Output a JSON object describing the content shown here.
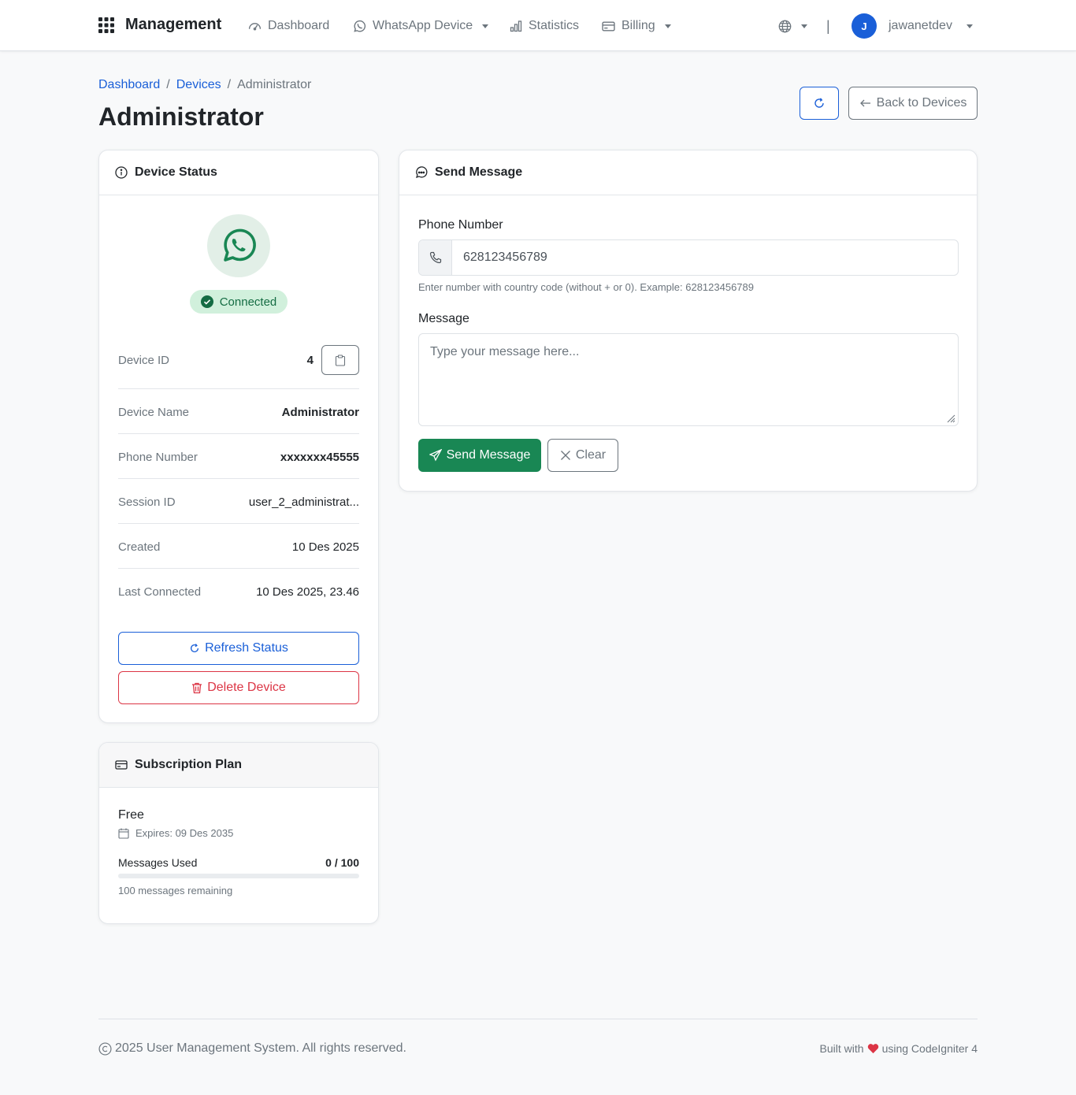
{
  "navbar": {
    "brand": "Management",
    "items": [
      {
        "label": "Dashboard",
        "icon": "speedometer-icon"
      },
      {
        "label": "WhatsApp Device",
        "icon": "whatsapp-icon"
      },
      {
        "label": "Statistics",
        "icon": "bar-chart-icon"
      },
      {
        "label": "Billing",
        "icon": "credit-card-icon"
      }
    ],
    "separator": "|",
    "user": {
      "initial": "J",
      "name": "jawanetdev"
    }
  },
  "breadcrumb": {
    "items": [
      "Dashboard",
      "Devices",
      "Administrator"
    ],
    "separator": "/"
  },
  "page": {
    "title": "Administrator",
    "back_label": "Back to Devices"
  },
  "device_status": {
    "title": "Device Status",
    "status": "Connected",
    "rows": [
      {
        "label": "Device ID",
        "value": "4"
      },
      {
        "label": "Device Name",
        "value": "Administrator"
      },
      {
        "label": "Phone Number",
        "value": "xxxxxxx45555"
      },
      {
        "label": "Session ID",
        "value": "user_2_administrat..."
      },
      {
        "label": "Created",
        "value": "10 Des 2025"
      },
      {
        "label": "Last Connected",
        "value": "10 Des 2025, 23.46"
      }
    ],
    "refresh_label": "Refresh Status",
    "delete_label": "Delete Device"
  },
  "subscription": {
    "title": "Subscription Plan",
    "plan": "Free",
    "expires": "Expires: 09 Des 2035",
    "messages_label": "Messages Used",
    "messages_value": "0 / 100",
    "usage_fraction": 0,
    "remaining": "100 messages remaining"
  },
  "send_message": {
    "title": "Send Message",
    "phone_label": "Phone Number",
    "phone_value": "628123456789",
    "phone_help": "Enter number with country code (without + or 0). Example: 628123456789",
    "message_label": "Message",
    "message_placeholder": "Type your message here...",
    "send_label": "Send Message",
    "clear_label": "Clear"
  },
  "footer": {
    "copyright": "2025 User Management System. All rights reserved.",
    "built_prefix": "Built with",
    "built_suffix": "using CodeIgniter 4"
  },
  "colors": {
    "primary": "#1a5fd8",
    "success": "#198754",
    "danger": "#dc3545",
    "whatsapp": "#198754"
  }
}
